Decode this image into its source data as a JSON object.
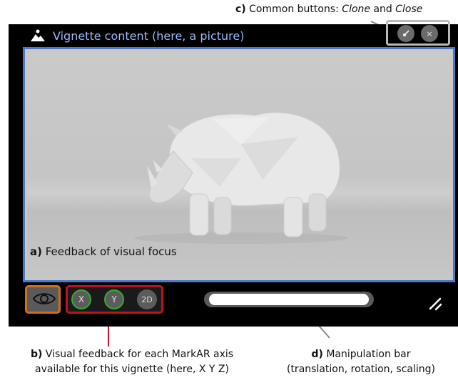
{
  "annotations": {
    "top_prefix": "c)",
    "top_text": " Common buttons: ",
    "top_clone": "Clone",
    "top_and": " and ",
    "top_close": "Close",
    "focus_prefix": "a)",
    "focus_text": " Feedback of visual focus",
    "b_prefix": "b)",
    "b_line1": " Visual feedback for each MarkAR axis",
    "b_line2": "available for this vignette (here, X Y Z)",
    "d_prefix": "d)",
    "d_line1": " Manipulation bar",
    "d_line2": "(translation, rotation, scaling)"
  },
  "vignette": {
    "title": "Vignette content (here, a picture)",
    "clone_glyph": "⤢",
    "close_glyph": "×"
  },
  "axis_buttons": {
    "x": "X",
    "y": "Y",
    "z": "2D"
  },
  "colors": {
    "focus_outline": "#d06f1f",
    "axis_outline": "#c1121f",
    "axis_active_ring": "#2fae2f",
    "content_outline": "#4f77c8",
    "title_color": "#9db8ff"
  }
}
